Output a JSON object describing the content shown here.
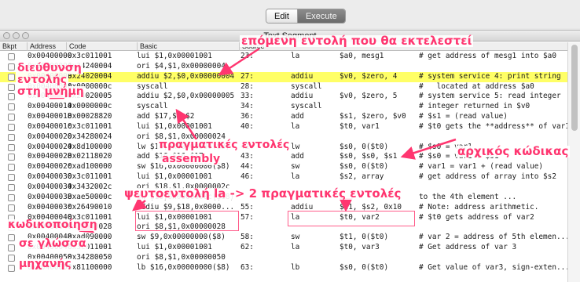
{
  "tabs": [
    {
      "label": "Edit",
      "selected": false
    },
    {
      "label": "Execute",
      "selected": true
    }
  ],
  "window": {
    "title": "Text Segment"
  },
  "columns": [
    "Bkpt",
    "Address",
    "Code",
    "Basic",
    "Source"
  ],
  "rows": [
    {
      "address": "0x00400000",
      "code": "0x3c011001",
      "basic": "lui $1,0x00001001",
      "line": "23:",
      "op": "la",
      "args": "$a0, mesg1",
      "comment": "# get address of mesg1 into $a0",
      "highlight": false
    },
    {
      "address": "0x00400004",
      "code": "0x34240004",
      "basic": "ori $4,$1,0x00000004",
      "line": "",
      "op": "",
      "args": "",
      "comment": "",
      "highlight": false
    },
    {
      "address": "0x00400008",
      "code": "0x24020004",
      "basic": "addiu $2,$0,0x00000004",
      "line": "27:",
      "op": "addiu",
      "args": "$v0, $zero, 4",
      "comment": "# system service 4: print string",
      "highlight": true
    },
    {
      "address": "0x0040000c",
      "code": "0x0000000c",
      "basic": "syscall",
      "line": "28:",
      "op": "syscall",
      "args": "",
      "comment": "#   located at address $a0",
      "highlight": false
    },
    {
      "address": "0x00400010",
      "code": "0x24020005",
      "basic": "addiu $2,$0,0x00000005",
      "line": "33:",
      "op": "addiu",
      "args": "$v0, $zero, 5",
      "comment": "# system service 5: read integer",
      "highlight": false
    },
    {
      "address": "0x00400014",
      "code": "0x0000000c",
      "basic": "syscall",
      "line": "34:",
      "op": "syscall",
      "args": "",
      "comment": "# integer returned in $v0",
      "highlight": false
    },
    {
      "address": "0x00400018",
      "code": "0x00028820",
      "basic": "add $17,$0,$2",
      "line": "36:",
      "op": "add",
      "args": "$s1, $zero, $v0",
      "comment": "# $s1 = (read value)",
      "highlight": false
    },
    {
      "address": "0x0040001c",
      "code": "0x3c011001",
      "basic": "lui $1,0x00001001",
      "line": "40:",
      "op": "la",
      "args": "$t0, var1",
      "comment": "# $t0 gets the **address** of var1",
      "highlight": false
    },
    {
      "address": "0x00400020",
      "code": "0x34280024",
      "basic": "ori $8,$1,0x00000024",
      "line": "",
      "op": "",
      "args": "",
      "comment": "",
      "highlight": false
    },
    {
      "address": "0x00400024",
      "code": "0x8d100000",
      "basic": "lw $16,0x00000000($8)",
      "line": "42:",
      "op": "lw",
      "args": "$s0, 0($t0)",
      "comment": "# $s0 = var1",
      "highlight": false
    },
    {
      "address": "0x00400028",
      "code": "0x02118020",
      "basic": "add $16,$16,$17",
      "line": "43:",
      "op": "add",
      "args": "$s0, $s0, $s1",
      "comment": "# $s0 = var1 + $s1",
      "highlight": false
    },
    {
      "address": "0x0040002c",
      "code": "0xad100000",
      "basic": "sw $16,0x00000000($8)",
      "line": "44:",
      "op": "sw",
      "args": "$s0, 0($t0)",
      "comment": "# var1 = var1 + (read value)",
      "highlight": false
    },
    {
      "address": "0x00400030",
      "code": "0x3c011001",
      "basic": "lui $1,0x00001001",
      "line": "46:",
      "op": "la",
      "args": "$s2, array",
      "comment": "# get address of array into $s2",
      "highlight": false
    },
    {
      "address": "0x00400034",
      "code": "0x3432002c",
      "basic": "ori $18,$1,0x0000002c",
      "line": "",
      "op": "",
      "args": "",
      "comment": "",
      "highlight": false
    },
    {
      "address": "0x00400038",
      "code": "0xae50000c",
      "basic": "sw $16,0x0000000c($18)",
      "line": "",
      "op": "",
      "args": "",
      "comment": "to the 4th element ...",
      "highlight": false
    },
    {
      "address": "0x0040003c",
      "code": "0x26490010",
      "basic": "addiu $9,$18,0x0000...",
      "line": "55:",
      "op": "addiu",
      "args": "$t1, $s2, 0x10",
      "comment": "# Note: address arithmetic.",
      "highlight": false
    },
    {
      "address": "0x00400040",
      "code": "0x3c011001",
      "basic": "lui $1,0x00001001",
      "line": "57:",
      "op": "la",
      "args": "$t0, var2",
      "comment": "# $t0 gets address of var2",
      "highlight": false
    },
    {
      "address": "0x00400044",
      "code": "0x34280028",
      "basic": "ori $8,$1,0x00000028",
      "line": "",
      "op": "",
      "args": "",
      "comment": "",
      "highlight": false
    },
    {
      "address": "0x00400048",
      "code": "0xad090000",
      "basic": "sw $9,0x00000000($8)",
      "line": "58:",
      "op": "sw",
      "args": "$t1, 0($t0)",
      "comment": "# var 2 = address of 5th elemen...",
      "highlight": false
    },
    {
      "address": "0x0040004c",
      "code": "0x3c011001",
      "basic": "lui $1,0x00001001",
      "line": "62:",
      "op": "la",
      "args": "$t0, var3",
      "comment": "# Get address of var 3",
      "highlight": false
    },
    {
      "address": "0x00400050",
      "code": "0x34280050",
      "basic": "ori $8,$1,0x00000050",
      "line": "",
      "op": "",
      "args": "",
      "comment": "",
      "highlight": false
    },
    {
      "address": "0x00400054",
      "code": "0x81100000",
      "basic": "lb $16,0x00000000($8)",
      "line": "63:",
      "op": "lb",
      "args": "$s0, 0($t0)",
      "comment": "# Get value of var3, sign-exten...",
      "highlight": false
    }
  ],
  "annotations": {
    "next_instruction": "επόμενη εντολή που θα εκτελεστεί",
    "address_1": "διεύθυνση",
    "address_2": "εντολής",
    "address_3": "στη μνήμη",
    "real_instructions": "πραγματικές εντολές",
    "assembly": "assembly",
    "source_code": "αρχικός κώδικας",
    "pseudo": "ψευτοεντολή la -> 2 πραγματικές εντολές",
    "encoding_1": "κωδικοποίηση",
    "encoding_2": "σε γλώσσα",
    "encoding_3": "μηχανής"
  },
  "colors": {
    "annotation": "#ff3670",
    "highlight_row": "#ffff66",
    "execute_tab": "#7a7a7a"
  }
}
